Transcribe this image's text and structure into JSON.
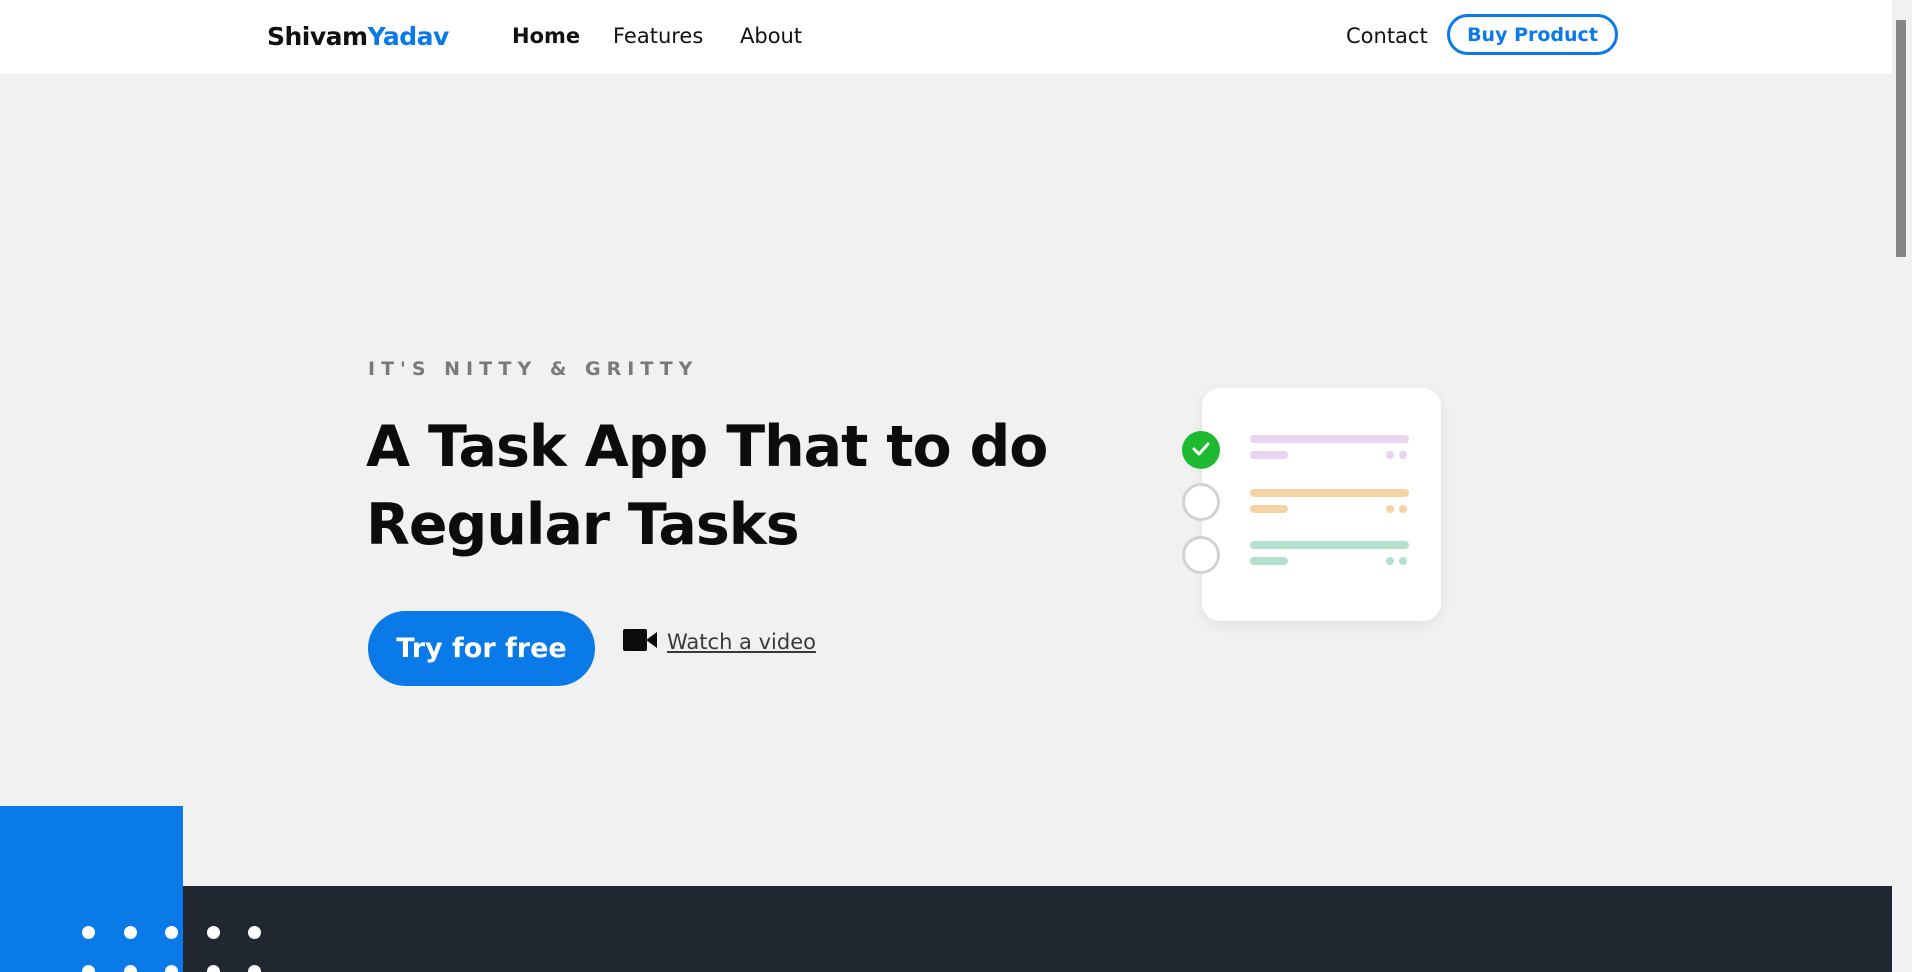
{
  "navbar": {
    "brand_first": "Shivam",
    "brand_second": "Yadav",
    "links": [
      {
        "label": "Home",
        "active": true
      },
      {
        "label": "Features",
        "active": false
      },
      {
        "label": "About",
        "active": false
      }
    ],
    "contact_label": "Contact",
    "buy_label": "Buy Product"
  },
  "hero": {
    "eyebrow": "IT'S NITTY & GRITTY",
    "title_line1": "A Task App That to do",
    "title_line2": "Regular Tasks",
    "cta_label": "Try for free",
    "video_label": "Watch a video",
    "video_icon": "video-camera-icon"
  },
  "task_card": {
    "items": [
      {
        "done": true,
        "color": "#e8d3f3",
        "icon": "check-icon"
      },
      {
        "done": false,
        "color": "#f6d3a5",
        "icon": ""
      },
      {
        "done": false,
        "color": "#b3e0cc",
        "icon": ""
      }
    ]
  },
  "colors": {
    "accent": "#0a7ae8",
    "page_background": "#f1f1f1",
    "dark_section": "#212730",
    "success": "#1db92f"
  }
}
